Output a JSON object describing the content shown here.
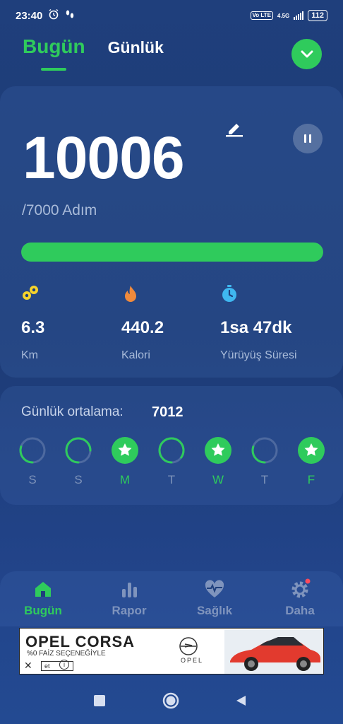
{
  "status_bar": {
    "time": "23:40",
    "network_badge": "Vo LTE",
    "network_type": "4.5G",
    "battery": "112"
  },
  "header": {
    "tabs": [
      {
        "label": "Bugün",
        "active": true
      },
      {
        "label": "Günlük",
        "active": false
      }
    ]
  },
  "today": {
    "steps": "10006",
    "goal_label": "/7000 Adım",
    "progress_fraction": 1.0,
    "stats": [
      {
        "icon": "location-pins-icon",
        "value": "6.3",
        "label": "Km",
        "color": "#f6d32b"
      },
      {
        "icon": "flame-icon",
        "value": "440.2",
        "label": "Kalori",
        "color": "#f08a3c"
      },
      {
        "icon": "stopwatch-icon",
        "value": "1sa 47dk",
        "label": "Yürüyüş Süresi",
        "color": "#3fb7f0"
      }
    ]
  },
  "weekly": {
    "average_label": "Günlük ortalama:",
    "average_value": "7012",
    "days": [
      {
        "label": "S",
        "goal_met": false,
        "fraction": 0.3
      },
      {
        "label": "S",
        "goal_met": false,
        "fraction": 0.75
      },
      {
        "label": "M",
        "goal_met": true,
        "fraction": 1.0
      },
      {
        "label": "T",
        "goal_met": false,
        "fraction": 0.85
      },
      {
        "label": "W",
        "goal_met": true,
        "fraction": 1.0
      },
      {
        "label": "T",
        "goal_met": false,
        "fraction": 0.3
      },
      {
        "label": "F",
        "goal_met": true,
        "fraction": 1.0
      }
    ]
  },
  "bottom_nav": {
    "items": [
      {
        "label": "Bugün",
        "icon": "home-icon",
        "active": true
      },
      {
        "label": "Rapor",
        "icon": "bar-chart-icon",
        "active": false
      },
      {
        "label": "Sağlık",
        "icon": "heart-pulse-icon",
        "active": false
      },
      {
        "label": "Daha",
        "icon": "gear-icon",
        "active": false
      }
    ]
  },
  "ad": {
    "title": "OPEL CORSA",
    "subtitle": "%0 FAİZ SEÇENEĞİYLE",
    "cta": "et",
    "brand": "OPEL"
  },
  "colors": {
    "accent": "#2fcb5c",
    "background": "#1f3f7c",
    "muted_text": "#a9bbd9"
  }
}
